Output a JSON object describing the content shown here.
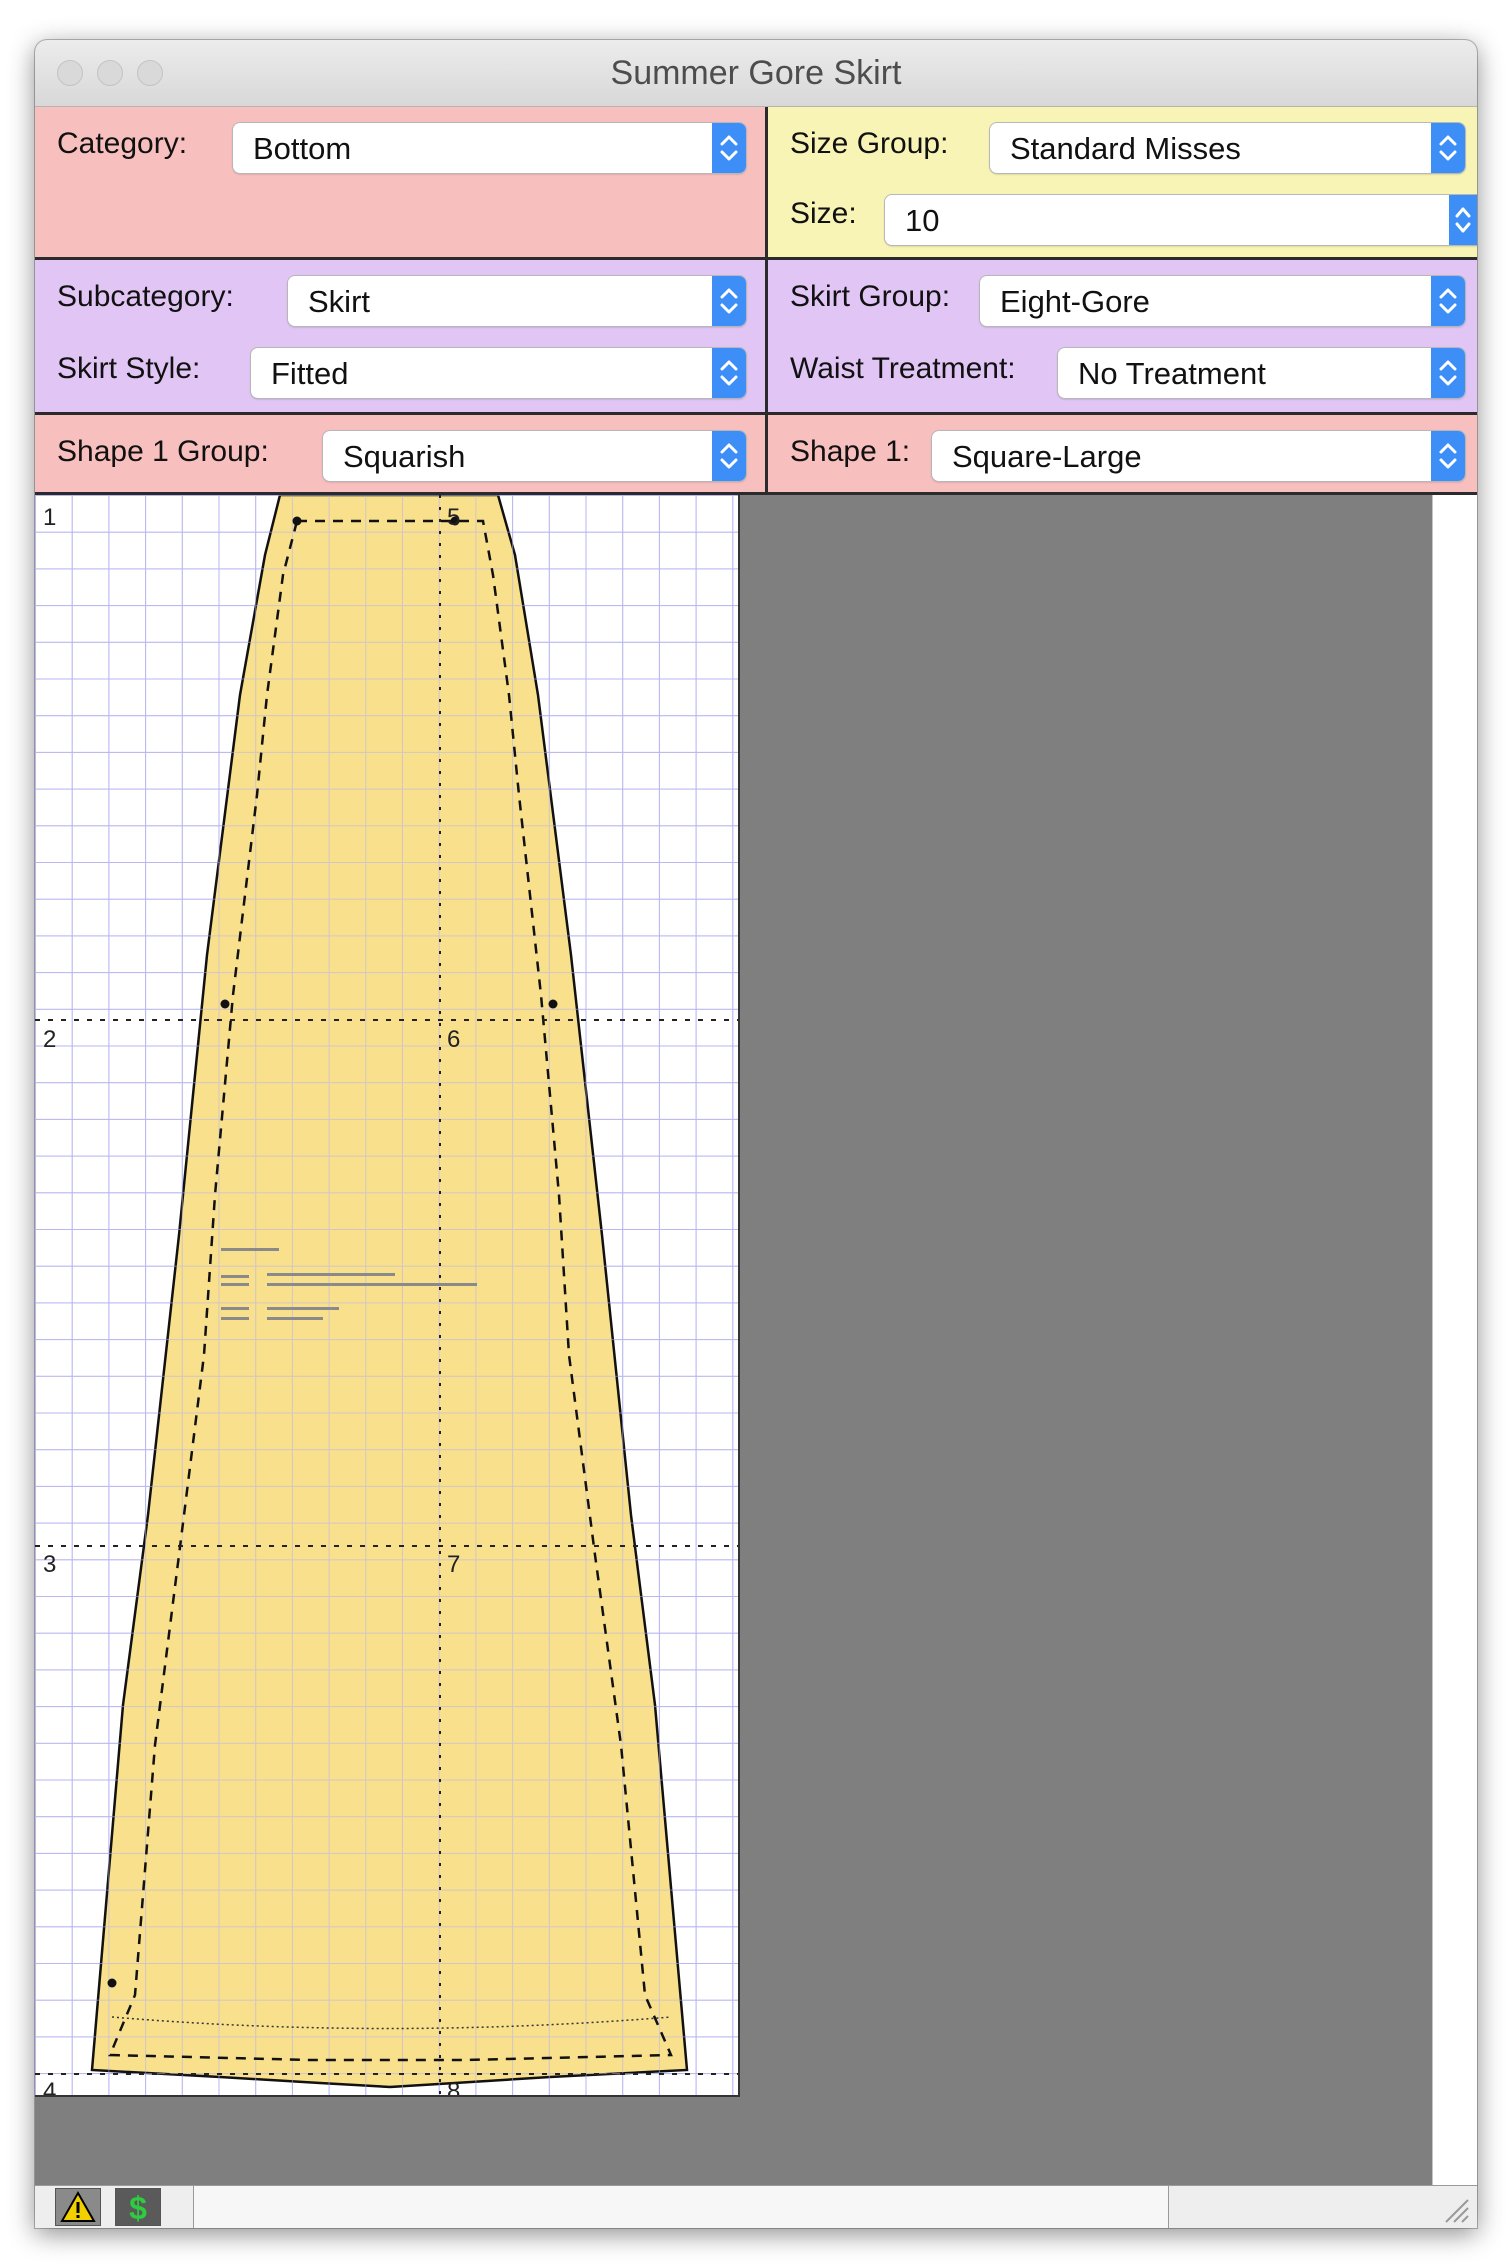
{
  "window": {
    "title": "Summer Gore Skirt"
  },
  "fields": {
    "category": {
      "label": "Category:",
      "value": "Bottom"
    },
    "size_group": {
      "label": "Size Group:",
      "value": "Standard Misses"
    },
    "size": {
      "label": "Size:",
      "value": "10"
    },
    "subcategory": {
      "label": "Subcategory:",
      "value": "Skirt"
    },
    "skirt_group": {
      "label": "Skirt Group:",
      "value": "Eight-Gore"
    },
    "skirt_style": {
      "label": "Skirt Style:",
      "value": "Fitted"
    },
    "waist_treatment": {
      "label": "Waist Treatment:",
      "value": "No Treatment"
    },
    "shape1_group": {
      "label": "Shape 1 Group:",
      "value": "Squarish"
    },
    "shape1": {
      "label": "Shape 1:",
      "value": "Square-Large"
    }
  },
  "pattern": {
    "row_markers": [
      "1",
      "2",
      "3",
      "4"
    ],
    "center_markers": [
      "5",
      "6",
      "7",
      "8"
    ],
    "fill_color": "#f7dd83",
    "grid_color": "#b9b6f0"
  },
  "toolbar": {
    "warning_icon": "warning-icon",
    "dollar_icon": "dollar-icon"
  },
  "colors": {
    "pink_panel": "#f8bfbf",
    "yellow_panel": "#f8f4b6",
    "purple_panel": "#e0c5f5",
    "popup_arrow": "#3d8ef7"
  }
}
